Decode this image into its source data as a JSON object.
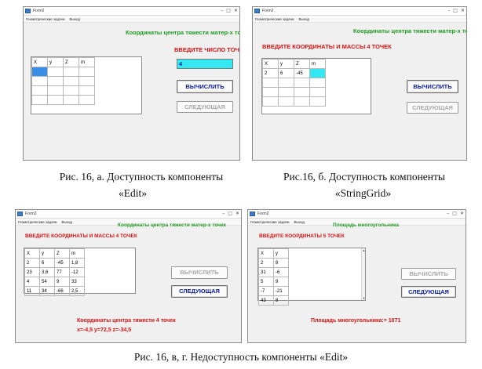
{
  "window_title": "Form2",
  "menu": [
    "Геометрические задачи",
    "Выход"
  ],
  "cm_title": "Координаты центра тяжести матер-х точек",
  "area_title": "Площадь многоугольника",
  "panel_a": {
    "label": "ВВЕДИТЕ ЧИСЛО ТОЧЕК",
    "headers": [
      "X",
      "y",
      "Z",
      "m"
    ],
    "edit_value": "4",
    "compute": "ВЫЧИСЛИТЬ",
    "next": "СЛЕДУЮЩАЯ"
  },
  "panel_b": {
    "label": "ВВЕДИТЕ КООРДИНАТЫ И МАССЫ 4 ТОЧЕК",
    "headers": [
      "X",
      "y",
      "Z",
      "m"
    ],
    "row1": [
      "2",
      "6",
      "-45",
      ""
    ],
    "compute": "ВЫЧИСЛИТЬ",
    "next": "СЛЕДУЮЩАЯ"
  },
  "panel_c": {
    "label": "ВВЕДИТЕ КООРДИНАТЫ И МАССЫ 4 ТОЧЕК",
    "headers": [
      "X",
      "y",
      "Z",
      "m"
    ],
    "rows": [
      [
        "2",
        "6",
        "-45",
        "1,8"
      ],
      [
        "23",
        "3,6",
        "77",
        "-12"
      ],
      [
        "4",
        "54",
        "9",
        "33"
      ],
      [
        "11",
        "34",
        "-66",
        "2,5"
      ]
    ],
    "compute": "ВЫЧИСЛИТЬ",
    "next": "СЛЕДУЮЩАЯ",
    "result_line1": "Координаты центра тяжести 4 точек",
    "result_line2": "x=-4,5   y=72,5   z=-34,5"
  },
  "panel_d": {
    "label": "ВВЕДИТЕ КООРДИНАТЫ 5 ТОЧЕК",
    "headers": [
      "X",
      "y"
    ],
    "rows": [
      [
        "2",
        "8"
      ],
      [
        "31",
        "-6"
      ],
      [
        "5",
        "9"
      ],
      [
        "-7",
        "-21"
      ],
      [
        "43",
        "8"
      ]
    ],
    "compute": "ВЫЧИСЛИТЬ",
    "next": "СЛЕДУЮЩАЯ",
    "result": "Площадь многоугольника:= 1071"
  },
  "captions": {
    "a_line1": "Рис. 16, а. Доступность компоненты",
    "a_line2": "«Edit»",
    "b_line1": "Рис.16, б. Доступность компоненты",
    "b_line2": "«StringGrid»",
    "cd": "Рис. 16, в, г. Недоступность компоненты «Edit»"
  }
}
